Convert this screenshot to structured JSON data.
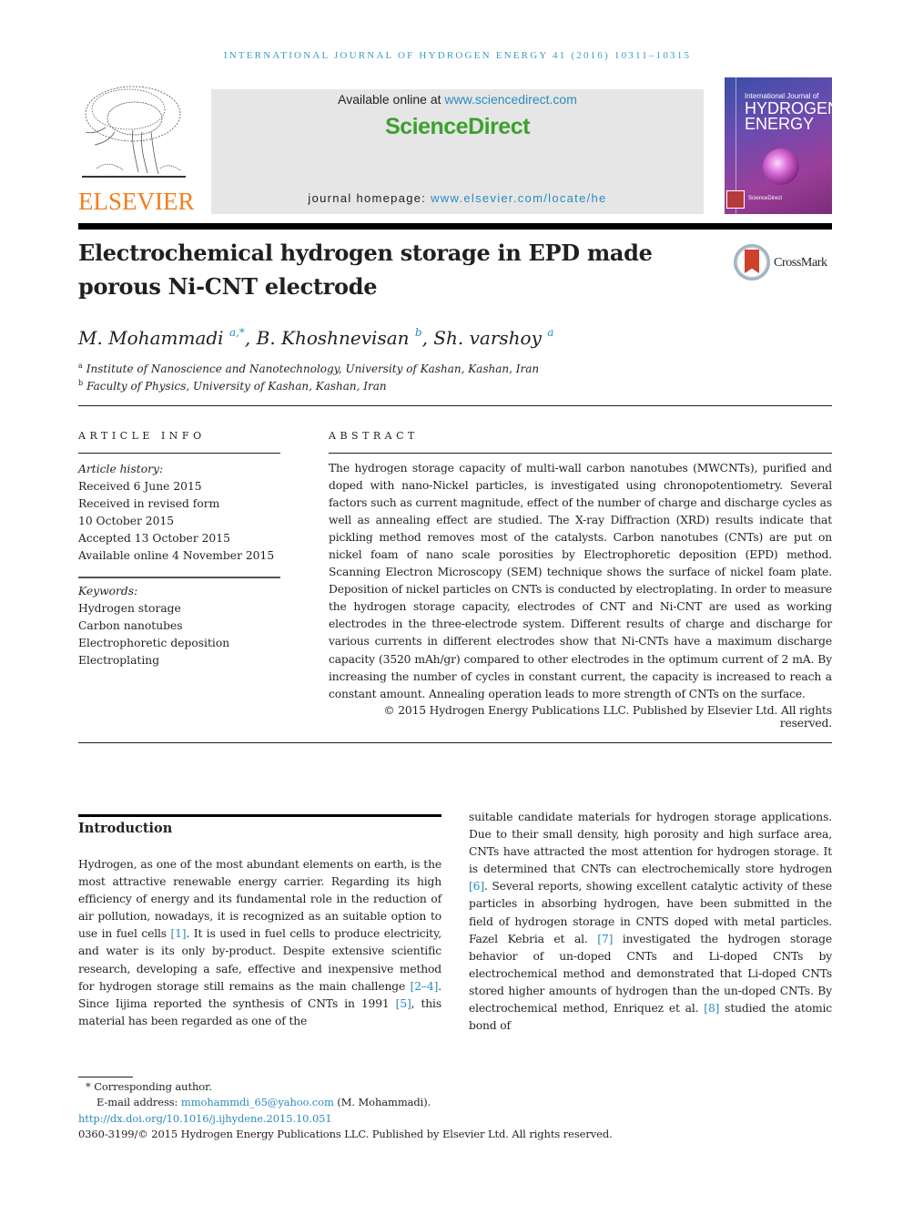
{
  "running_head": "INTERNATIONAL JOURNAL OF HYDROGEN ENERGY 41 (2016) 10311–10315",
  "masthead": {
    "publisher_logo": "ELSEVIER",
    "available_online_prefix": "Available online at ",
    "available_online_link": "www.sciencedirect.com",
    "platform_name": "ScienceDirect",
    "homepage_prefix": "journal homepage: ",
    "homepage_link": "www.elsevier.com/locate/he",
    "cover": {
      "title_small": "International Journal of",
      "title_large_1": "HYDROGEN",
      "title_large_2": "ENERGY",
      "bottom_label": "ScienceDirect"
    }
  },
  "article": {
    "title": "Electrochemical hydrogen storage in EPD made porous Ni-CNT electrode",
    "crossmark_label": "CrossMark",
    "authors": [
      {
        "name": "M. Mohammadi",
        "sup": "a,*",
        "sep": ", "
      },
      {
        "name": "B. Khoshnevisan",
        "sup": "b",
        "sep": ", "
      },
      {
        "name": "Sh. varshoy",
        "sup": "a",
        "sep": ""
      }
    ],
    "affiliations": [
      {
        "mark": "a",
        "text": "Institute of Nanoscience and Nanotechnology, University of Kashan, Kashan, Iran"
      },
      {
        "mark": "b",
        "text": "Faculty of Physics, University of Kashan, Kashan, Iran"
      }
    ]
  },
  "article_info": {
    "label": "ARTICLE INFO",
    "history_heading": "Article history:",
    "history": [
      "Received 6 June 2015",
      "Received in revised form",
      "10 October 2015",
      "Accepted 13 October 2015",
      "Available online 4 November 2015"
    ],
    "keywords_heading": "Keywords:",
    "keywords": [
      "Hydrogen storage",
      "Carbon nanotubes",
      "Electrophoretic deposition",
      "Electroplating"
    ]
  },
  "abstract": {
    "label": "ABSTRACT",
    "text": "The hydrogen storage capacity of multi-wall carbon nanotubes (MWCNTs), purified and doped with nano-Nickel particles, is investigated using chronopotentiometry. Several factors such as current magnitude, effect of the number of charge and discharge cycles as well as annealing effect are studied. The X-ray Diffraction (XRD) results indicate that pickling method removes most of the catalysts. Carbon nanotubes (CNTs) are put on nickel foam of nano scale porosities by Electrophoretic deposition (EPD) method. Scanning Elec­tron Microscopy (SEM) technique shows the surface of nickel foam plate. Deposition of nickel particles on CNTs is conducted by electroplating. In order to measure the hydrogen storage capacity, electrodes of CNT and Ni-CNT are used as working electrodes in the three-electrode system. Different results of charge and discharge for various currents in different electrodes show that Ni-CNTs have a maximum discharge capacity (3520 mAh/gr) compared to other electrodes in the optimum current of 2 mA. By increasing the number of cycles in constant current, the capacity is increased to reach a constant amount. Annealing operation leads to more strength of CNTs on the surface.",
    "copyright": "© 2015 Hydrogen Energy Publications LLC. Published by Elsevier Ltd. All rights reserved."
  },
  "introduction": {
    "heading": "Introduction",
    "left_column": [
      {
        "t": "Hydrogen, as one of the most abundant elements on earth, is the most attractive renewable energy carrier. Regarding its high efficiency of energy and its fundamental role in the reduction of air pollution, nowadays, it is recognized as an suitable option to use in fuel cells "
      },
      {
        "ref": "[1]"
      },
      {
        "t": ". It is used in fuel cells to produce electricity, and water is its only by-product. Despite extensive scientific research, developing a safe, effective and inexpensive method for hydrogen storage still remains as the main challenge "
      },
      {
        "ref": "[2–4]"
      },
      {
        "t": ". Since Iijima reported the synthesis of CNTs in 1991 "
      },
      {
        "ref": "[5]"
      },
      {
        "t": ", this material has been regarded as one of the"
      }
    ],
    "right_column": [
      {
        "t": "suitable candidate materials for hydrogen storage applica­tions. Due to their small density, high porosity and high sur­face area, CNTs have attracted the most attention for hydrogen storage. It is determined that CNTs can electro­chemically store hydrogen "
      },
      {
        "ref": "[6]"
      },
      {
        "t": ". Several reports, showing excellent catalytic activity of these particles in absorbing hydrogen, have been submitted in the field of hydrogen stor­age in CNTS doped with metal particles. Fazel Kebria et al. "
      },
      {
        "ref": "[7]"
      },
      {
        "t": " investigated the hydrogen storage behavior of un-doped CNTs and Li-doped CNTs by electrochemical method and demon­strated that Li-doped CNTs stored higher amounts of hydrogen than the un-doped CNTs. By electrochemical method, Enriquez et al. "
      },
      {
        "ref": "[8]"
      },
      {
        "t": " studied the atomic bond of"
      }
    ]
  },
  "footnotes": {
    "corresponding_mark": "*",
    "corresponding_label": "Corresponding author.",
    "email_prefix": "E-mail address: ",
    "email": "mmohammdi_65@yahoo.com",
    "email_suffix": " (M. Mohammadi).",
    "doi": "http://dx.doi.org/10.1016/j.ijhydene.2015.10.051",
    "issn_copyright": "0360-3199/© 2015 Hydrogen Energy Publications LLC. Published by Elsevier Ltd. All rights reserved."
  },
  "colors": {
    "link": "#2a8bbf",
    "running_head": "#3a9cc4",
    "elsevier_orange": "#f07f1c",
    "sciencedirect_green": "#3ca12e",
    "masthead_gray": "#e6e6e6"
  }
}
